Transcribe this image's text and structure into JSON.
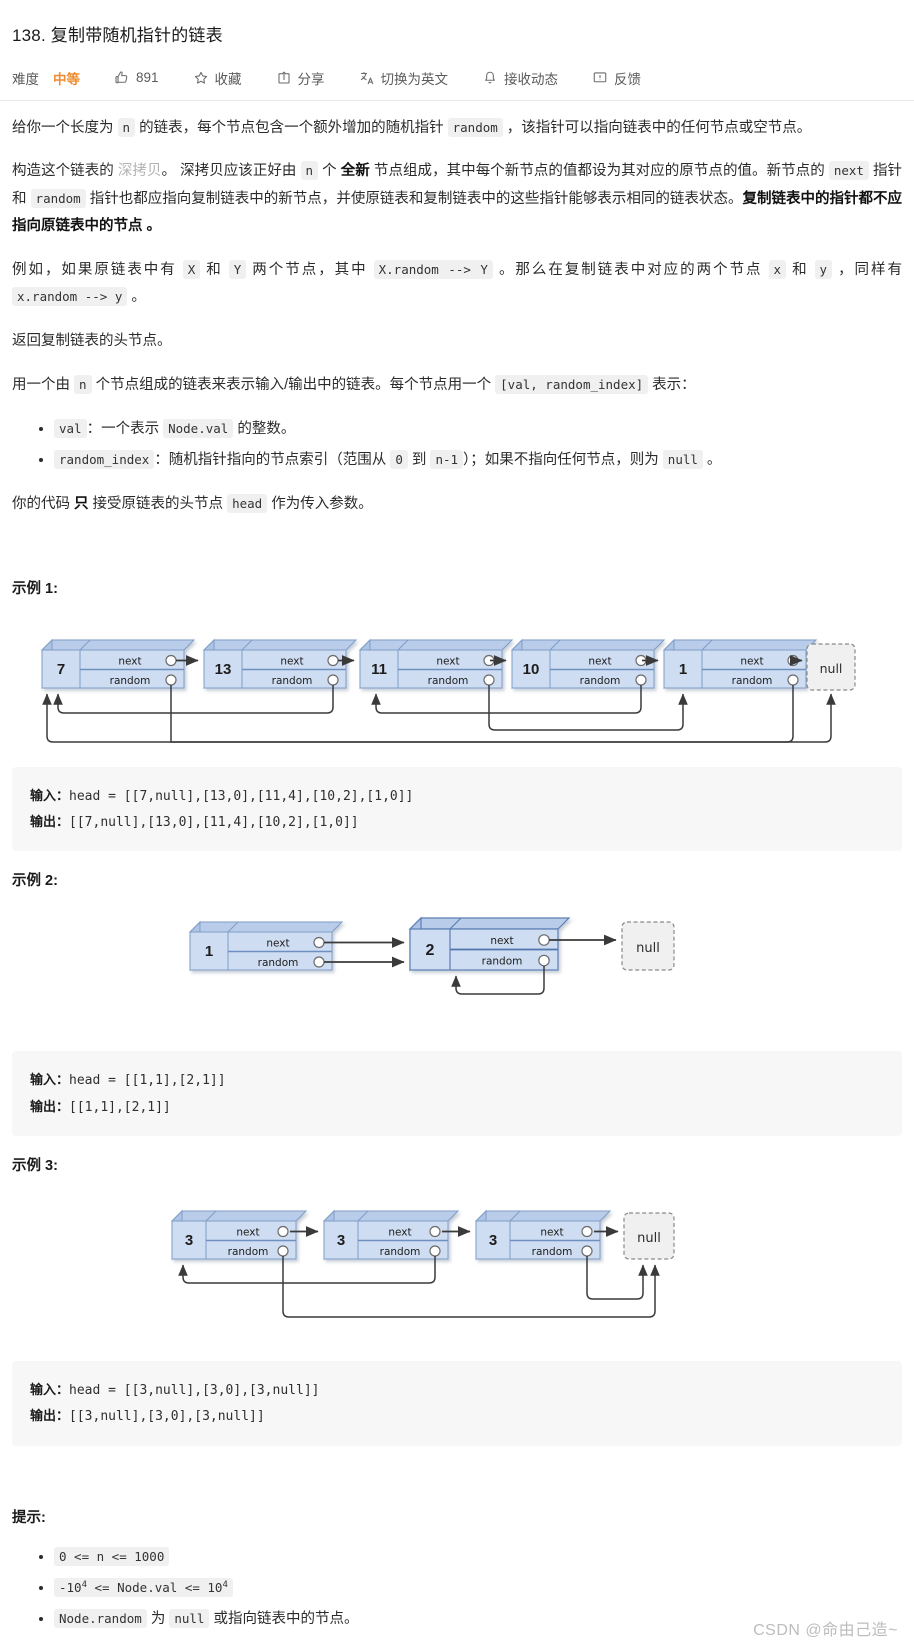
{
  "header": {
    "title": "138. 复制带随机指针的链表",
    "difficulty_label": "难度",
    "difficulty_value": "中等",
    "difficulty_color": "#ef8c32",
    "actions": [
      {
        "icon": "thumbs-up-icon",
        "label": "891",
        "name": "like-count"
      },
      {
        "icon": "star-icon",
        "label": "收藏",
        "name": "favorite"
      },
      {
        "icon": "share-icon",
        "label": "分享",
        "name": "share"
      },
      {
        "icon": "translate-icon",
        "label": "切换为英文",
        "name": "switch-language"
      },
      {
        "icon": "bell-icon",
        "label": "接收动态",
        "name": "subscribe"
      },
      {
        "icon": "feedback-icon",
        "label": "反馈",
        "name": "feedback"
      }
    ]
  },
  "description": {
    "p1": [
      {
        "t": "给你一个长度为 "
      },
      {
        "t": "n",
        "code": true
      },
      {
        "t": " 的链表，每个节点包含一个额外增加的随机指针 "
      },
      {
        "t": "random",
        "code": true
      },
      {
        "t": " ，该指针可以指向链表中的任何节点或空节点。"
      }
    ],
    "p2": [
      {
        "t": "构造这个链表的 "
      },
      {
        "t": "深拷贝",
        "muted": true
      },
      {
        "t": "。 深拷贝应该正好由 "
      },
      {
        "t": "n",
        "code": true
      },
      {
        "t": " 个 "
      },
      {
        "t": "全新",
        "strong": true
      },
      {
        "t": " 节点组成，其中每个新节点的值都设为其对应的原节点的值。新节点的 "
      },
      {
        "t": "next",
        "code": true
      },
      {
        "t": " 指针和 "
      },
      {
        "t": "random",
        "code": true
      },
      {
        "t": " 指针也都应指向复制链表中的新节点，并使原链表和复制链表中的这些指针能够表示相同的链表状态。"
      },
      {
        "t": "复制链表中的指针都不应指向原链表中的节点 。",
        "strong": true
      }
    ],
    "p3": [
      {
        "t": "例如，如果原链表中有 "
      },
      {
        "t": "X",
        "code": true
      },
      {
        "t": " 和 "
      },
      {
        "t": "Y",
        "code": true
      },
      {
        "t": " 两个节点，其中 "
      },
      {
        "t": "X.random --> Y",
        "code": true
      },
      {
        "t": " 。那么在复制链表中对应的两个节点 "
      },
      {
        "t": "x",
        "code": true
      },
      {
        "t": " 和 "
      },
      {
        "t": "y",
        "code": true
      },
      {
        "t": " ，同样有 "
      },
      {
        "t": "x.random --> y",
        "code": true
      },
      {
        "t": " 。"
      }
    ],
    "p4": [
      {
        "t": "返回复制链表的头节点。"
      }
    ],
    "p5": [
      {
        "t": "用一个由 "
      },
      {
        "t": "n",
        "code": true
      },
      {
        "t": " 个节点组成的链表来表示输入/输出中的链表。每个节点用一个 "
      },
      {
        "t": "[val, random_index]",
        "code": true
      },
      {
        "t": " 表示："
      }
    ],
    "bullets": [
      [
        {
          "t": "val",
          "code": true
        },
        {
          "t": "：一个表示 "
        },
        {
          "t": "Node.val",
          "code": true
        },
        {
          "t": " 的整数。"
        }
      ],
      [
        {
          "t": "random_index",
          "code": true
        },
        {
          "t": "：随机指针指向的节点索引（范围从 "
        },
        {
          "t": "0",
          "code": true
        },
        {
          "t": " 到 "
        },
        {
          "t": "n-1",
          "code": true
        },
        {
          "t": "）；如果不指向任何节点，则为 "
        },
        {
          "t": "null",
          "code": true
        },
        {
          "t": " 。"
        }
      ]
    ],
    "p6": [
      {
        "t": "你的代码 "
      },
      {
        "t": "只",
        "strong": true
      },
      {
        "t": " 接受原链表的头节点 "
      },
      {
        "t": "head",
        "code": true
      },
      {
        "t": " 作为传入参数。"
      }
    ]
  },
  "examples": [
    {
      "title": "示例 1:",
      "input_label": "输入：",
      "input_value": "head = [[7,null],[13,0],[11,4],[10,2],[1,0]]",
      "output_label": "输出：",
      "output_value": "[[7,null],[13,0],[11,4],[10,2],[1,0]]",
      "diagram": {
        "node_labels": [
          "7",
          "13",
          "11",
          "10",
          "1"
        ],
        "next_label": "next",
        "random_label": "random",
        "null_label": "null",
        "random_targets": [
          "null",
          "0",
          "4",
          "2",
          "0"
        ]
      }
    },
    {
      "title": "示例 2:",
      "input_label": "输入：",
      "input_value": "head = [[1,1],[2,1]]",
      "output_label": "输出：",
      "output_value": "[[1,1],[2,1]]",
      "diagram": {
        "node_labels": [
          "1",
          "2"
        ],
        "next_label": "next",
        "random_label": "random",
        "null_label": "null",
        "random_targets": [
          "1",
          "1"
        ]
      }
    },
    {
      "title": "示例 3:",
      "input_label": "输入：",
      "input_value": "head = [[3,null],[3,0],[3,null]]",
      "output_label": "输出：",
      "output_value": "[[3,null],[3,0],[3,null]]",
      "diagram": {
        "node_labels": [
          "3",
          "3",
          "3"
        ],
        "next_label": "next",
        "random_label": "random",
        "null_label": "null",
        "random_targets": [
          "null",
          "0",
          "null"
        ]
      }
    }
  ],
  "hints": {
    "title": "提示:",
    "items": [
      [
        {
          "t": "0 <= n <= 1000",
          "code": true
        }
      ],
      [
        {
          "t": "-10",
          "code": true,
          "sup": "4",
          "tail": " <= Node.val <= 10",
          "sup2": "4"
        }
      ],
      [
        {
          "t": "Node.random",
          "code": true
        },
        {
          "t": " 为 "
        },
        {
          "t": "null",
          "code": true
        },
        {
          "t": " 或指向链表中的节点。"
        }
      ]
    ]
  },
  "watermark": "CSDN @命由己造~",
  "colors": {
    "node_fill": "#cfddf2",
    "node_top": "#b9cdea",
    "node_side": "#aec4e4",
    "node_stroke": "#7f9dc7",
    "null_fill": "#f0f0f0",
    "null_stroke": "#8a8a8a",
    "arrow": "#3a3a3a",
    "code_bg": "#f7f7f8",
    "inline_code_bg": "#f0f0f0"
  }
}
